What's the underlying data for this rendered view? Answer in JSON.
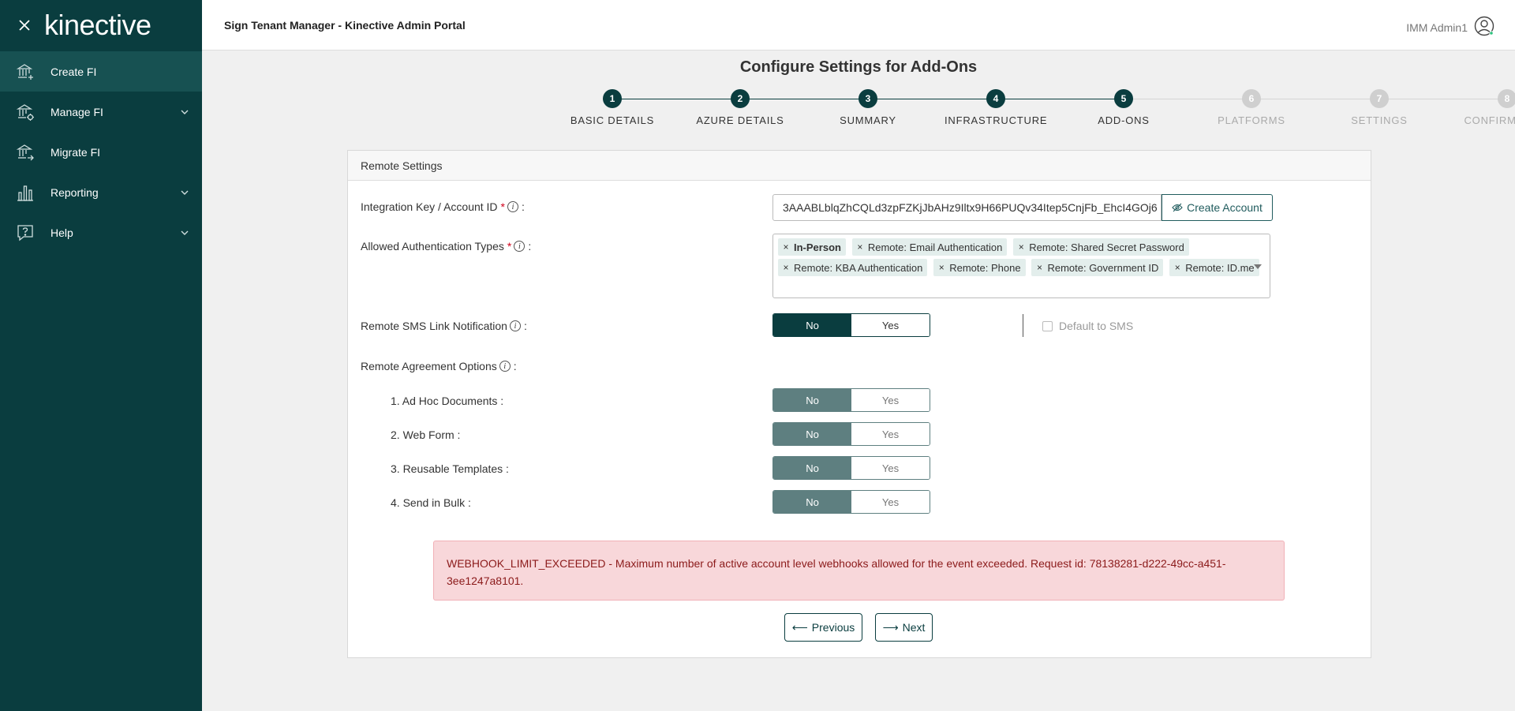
{
  "sidebar": {
    "logo": "kinective",
    "items": [
      {
        "label": "Create FI",
        "icon": "bank-plus-icon",
        "active": true,
        "has_chevron": false
      },
      {
        "label": "Manage FI",
        "icon": "bank-gear-icon",
        "active": false,
        "has_chevron": true
      },
      {
        "label": "Migrate FI",
        "icon": "bank-arrow-icon",
        "active": false,
        "has_chevron": false
      },
      {
        "label": "Reporting",
        "icon": "bar-chart-icon",
        "active": false,
        "has_chevron": true
      },
      {
        "label": "Help",
        "icon": "help-icon",
        "active": false,
        "has_chevron": true
      }
    ]
  },
  "header": {
    "title": "Sign Tenant Manager - Kinective Admin Portal",
    "user_name": "IMM Admin1"
  },
  "page": {
    "title": "Configure Settings for Add-Ons"
  },
  "stepper": {
    "steps": [
      {
        "number": "1",
        "label": "BASIC DETAILS",
        "state": "done"
      },
      {
        "number": "2",
        "label": "AZURE DETAILS",
        "state": "done"
      },
      {
        "number": "3",
        "label": "SUMMARY",
        "state": "done"
      },
      {
        "number": "4",
        "label": "INFRASTRUCTURE",
        "state": "done"
      },
      {
        "number": "5",
        "label": "ADD-ONS",
        "state": "current"
      },
      {
        "number": "6",
        "label": "PLATFORMS",
        "state": "upcoming"
      },
      {
        "number": "7",
        "label": "SETTINGS",
        "state": "upcoming"
      },
      {
        "number": "8",
        "label": "CONFIRMATION",
        "state": "upcoming"
      }
    ]
  },
  "panel": {
    "title": "Remote Settings",
    "integration_key": {
      "label": "Integration Key / Account ID",
      "value": "3AAABLblqZhCQLd3zpFZKjJbAHz9Iltx9H66PUQv34Itep5CnjFb_EhcI4GOj6",
      "button": "Create Account"
    },
    "auth_types": {
      "label": "Allowed Authentication Types",
      "tags": [
        "In-Person",
        "Remote: Email Authentication",
        "Remote: Shared Secret Password",
        "Remote: KBA Authentication",
        "Remote: Phone",
        "Remote: Government ID",
        "Remote: ID.me"
      ]
    },
    "sms": {
      "label": "Remote SMS Link Notification",
      "no": "No",
      "yes": "Yes",
      "selected": "No",
      "default_label": "Default to SMS",
      "default_checked": false
    },
    "agreement": {
      "label": "Remote Agreement Options",
      "options": [
        {
          "label": "1. Ad Hoc Documents :",
          "no": "No",
          "yes": "Yes",
          "selected": "No"
        },
        {
          "label": "2. Web Form :",
          "no": "No",
          "yes": "Yes",
          "selected": "No"
        },
        {
          "label": "3. Reusable Templates :",
          "no": "No",
          "yes": "Yes",
          "selected": "No"
        },
        {
          "label": "4. Send in Bulk :",
          "no": "No",
          "yes": "Yes",
          "selected": "No"
        }
      ]
    },
    "error": "WEBHOOK_LIMIT_EXCEEDED - Maximum number of active account level webhooks allowed for the event exceeded. Request id: 78138281-d222-49cc-a451-3ee1247a8101.",
    "prev_button": "Previous",
    "next_button": "Next"
  },
  "colors": {
    "sidebar_bg": "#0a3d3f",
    "sidebar_active": "#175152",
    "accent": "#0a3d3f",
    "alert_bg": "#f8d7da",
    "alert_text": "#8b1a1a"
  }
}
